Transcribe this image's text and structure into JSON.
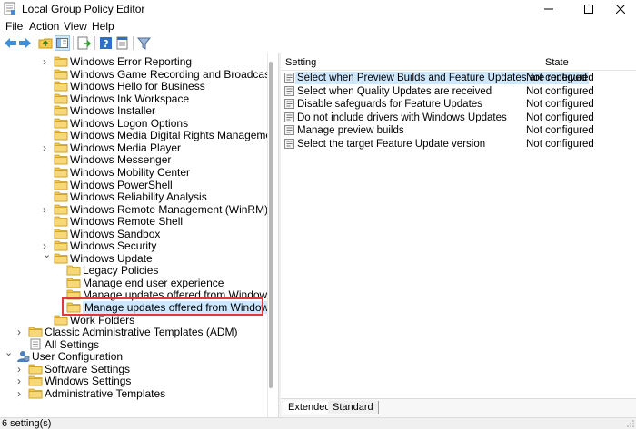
{
  "window": {
    "title": "Local Group Policy Editor"
  },
  "menu": {
    "items": [
      "File",
      "Action",
      "View",
      "Help"
    ]
  },
  "toolbar": {
    "icons": [
      "back-icon",
      "forward-icon",
      "up-folder-icon",
      "show-hide-tree-icon",
      "export-list-icon",
      "help-icon",
      "properties-icon",
      "filter-icon"
    ]
  },
  "tree": {
    "items": [
      {
        "label": "Windows Error Reporting",
        "expandable": true
      },
      {
        "label": "Windows Game Recording and Broadcasting",
        "expandable": false
      },
      {
        "label": "Windows Hello for Business",
        "expandable": false
      },
      {
        "label": "Windows Ink Workspace",
        "expandable": false
      },
      {
        "label": "Windows Installer",
        "expandable": false
      },
      {
        "label": "Windows Logon Options",
        "expandable": false
      },
      {
        "label": "Windows Media Digital Rights Management",
        "expandable": false
      },
      {
        "label": "Windows Media Player",
        "expandable": true
      },
      {
        "label": "Windows Messenger",
        "expandable": false
      },
      {
        "label": "Windows Mobility Center",
        "expandable": false
      },
      {
        "label": "Windows PowerShell",
        "expandable": false
      },
      {
        "label": "Windows Reliability Analysis",
        "expandable": false
      },
      {
        "label": "Windows Remote Management (WinRM)",
        "expandable": true
      },
      {
        "label": "Windows Remote Shell",
        "expandable": false
      },
      {
        "label": "Windows Sandbox",
        "expandable": false
      },
      {
        "label": "Windows Security",
        "expandable": true
      },
      {
        "label": "Windows Update",
        "expanded": true
      },
      {
        "label": "Legacy Policies",
        "child": true
      },
      {
        "label": "Manage end user experience",
        "child": true
      },
      {
        "label": "Manage updates offered from Windows Server Upd",
        "child": true
      },
      {
        "label": "Manage updates offered from Windows Update",
        "child": true,
        "selected": true
      },
      {
        "label": "Work Folders",
        "expandable": false
      },
      {
        "label": "Classic Administrative Templates (ADM)",
        "level": 1,
        "expandable": true
      },
      {
        "label": "All Settings",
        "level": 1,
        "expandable": false,
        "icon": "all-settings"
      },
      {
        "label": "User Configuration",
        "level": 0,
        "expanded": true,
        "icon": "user"
      },
      {
        "label": "Software Settings",
        "level": 1,
        "expandable": true
      },
      {
        "label": "Windows Settings",
        "level": 1,
        "expandable": true
      },
      {
        "label": "Administrative Templates",
        "level": 1,
        "expandable": true
      }
    ]
  },
  "list": {
    "headers": {
      "setting": "Setting",
      "state": "State"
    },
    "rows": [
      {
        "name": "Select when Preview Builds and Feature Updates are received",
        "state": "Not configured",
        "selected": true
      },
      {
        "name": "Select when Quality Updates are received",
        "state": "Not configured"
      },
      {
        "name": "Disable safeguards for Feature Updates",
        "state": "Not configured"
      },
      {
        "name": "Do not include drivers with Windows Updates",
        "state": "Not configured"
      },
      {
        "name": "Manage preview builds",
        "state": "Not configured"
      },
      {
        "name": "Select the target Feature Update version",
        "state": "Not configured"
      }
    ]
  },
  "tabs": {
    "extended": "Extended",
    "standard": "Standard"
  },
  "status": {
    "text": "6 setting(s)"
  },
  "colors": {
    "accent": "#cde8ff",
    "highlight": "#e0393e",
    "folder": "#f2c94c"
  }
}
